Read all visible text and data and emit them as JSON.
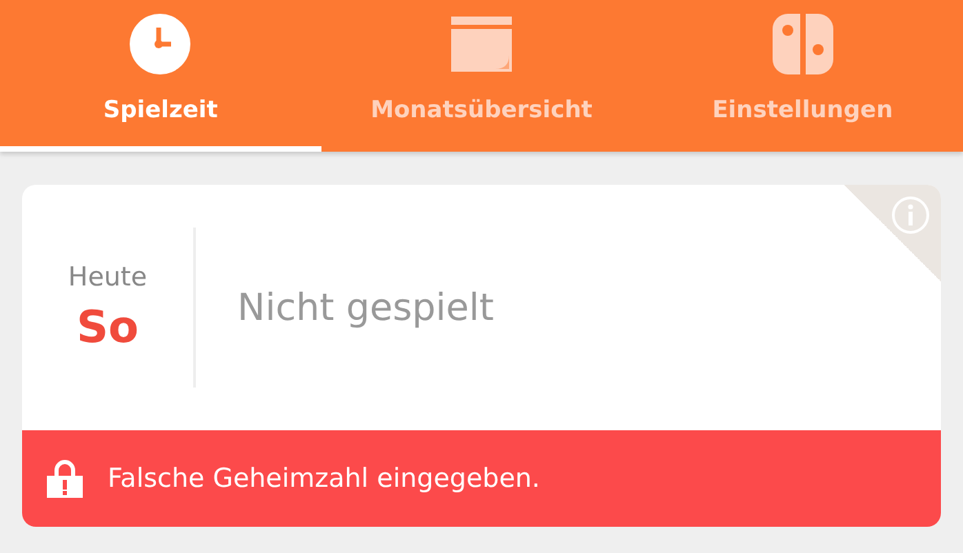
{
  "tabs": [
    {
      "label": "Spielzeit",
      "selected": true
    },
    {
      "label": "Monatsübersicht",
      "selected": false
    },
    {
      "label": "Einstellungen",
      "selected": false
    }
  ],
  "today": {
    "label": "Heute",
    "day": "So",
    "status": "Nicht gespielt"
  },
  "alert": {
    "message": "Falsche Geheimzahl eingegeben."
  }
}
